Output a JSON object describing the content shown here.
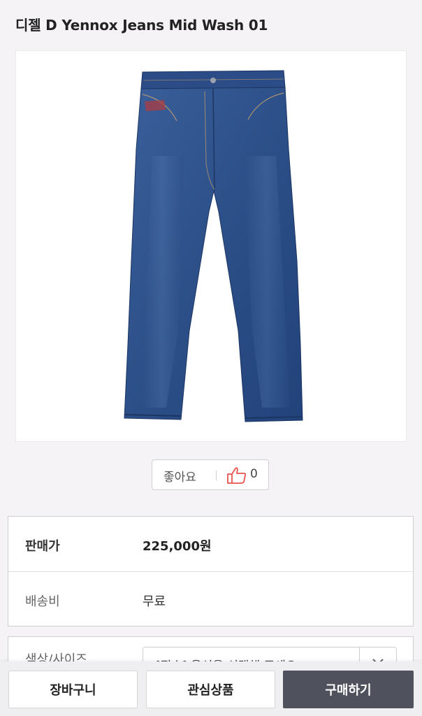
{
  "product": {
    "title": "디젤 D Yennox Jeans Mid Wash 01",
    "image_icon": "jeans-product-image"
  },
  "like": {
    "label": "좋아요",
    "count": "0",
    "icon": "thumbs-up-icon",
    "icon_color": "#e8534e"
  },
  "info": {
    "price_label": "판매가",
    "price_value": "225,000원",
    "shipping_label": "배송비",
    "shipping_value": "무료"
  },
  "options": {
    "label": "색상/사이즈",
    "select_text": "[필수] 옵션을 선택해 주세요"
  },
  "bottom_bar": {
    "cart_label": "장바구니",
    "wish_label": "관심상품",
    "buy_label": "구매하기",
    "buy_color": "#4f525d"
  }
}
